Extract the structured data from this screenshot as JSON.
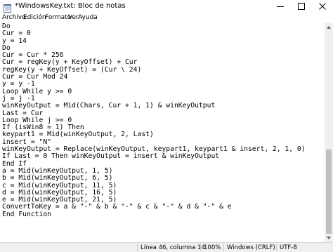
{
  "window": {
    "title": "*WindowsKey.txt: Bloc de notas",
    "icons": {
      "app": "notepad-icon",
      "minimize": "minimize-icon",
      "maximize": "maximize-icon",
      "close": "close-icon"
    }
  },
  "menu": {
    "items": [
      "Archivo",
      "Edición",
      "Formato",
      "Ver",
      "Ayuda"
    ]
  },
  "editor": {
    "lines": [
      "Do",
      "Cur = 0",
      "y = 14",
      "Do",
      "Cur = Cur * 256",
      "Cur = regKey(y + KeyOffset) + Cur",
      "regKey(y + KeyOffset) = (Cur \\ 24)",
      "Cur = Cur Mod 24",
      "y = y -1",
      "Loop While y >= 0",
      "j = j -1",
      "winKeyOutput = Mid(Chars, Cur + 1, 1) & winKeyOutput",
      "Last = Cur",
      "Loop While j >= 0",
      "If (isWin8 = 1) Then",
      "keypart1 = Mid(winKeyOutput, 2, Last)",
      "insert = \"N\"",
      "winKeyOutput = Replace(winKeyOutput, keypart1, keypart1 & insert, 2, 1, 0)",
      "If Last = 0 Then winKeyOutput = insert & winKeyOutput",
      "End If",
      "a = Mid(winKeyOutput, 1, 5)",
      "b = Mid(winKeyOutput, 6, 5)",
      "c = Mid(winKeyOutput, 11, 5)",
      "d = Mid(winKeyOutput, 16, 5)",
      "e = Mid(winKeyOutput, 21, 5)",
      "ConvertToKey = a & \"-\" & b & \"-\" & c & \"-\" & d & \"-\" & e",
      "End Function"
    ]
  },
  "status": {
    "position": "Línea 46, columna 14",
    "zoom": "100%",
    "line_ending": "Windows (CRLF)",
    "encoding": "UTF-8"
  }
}
